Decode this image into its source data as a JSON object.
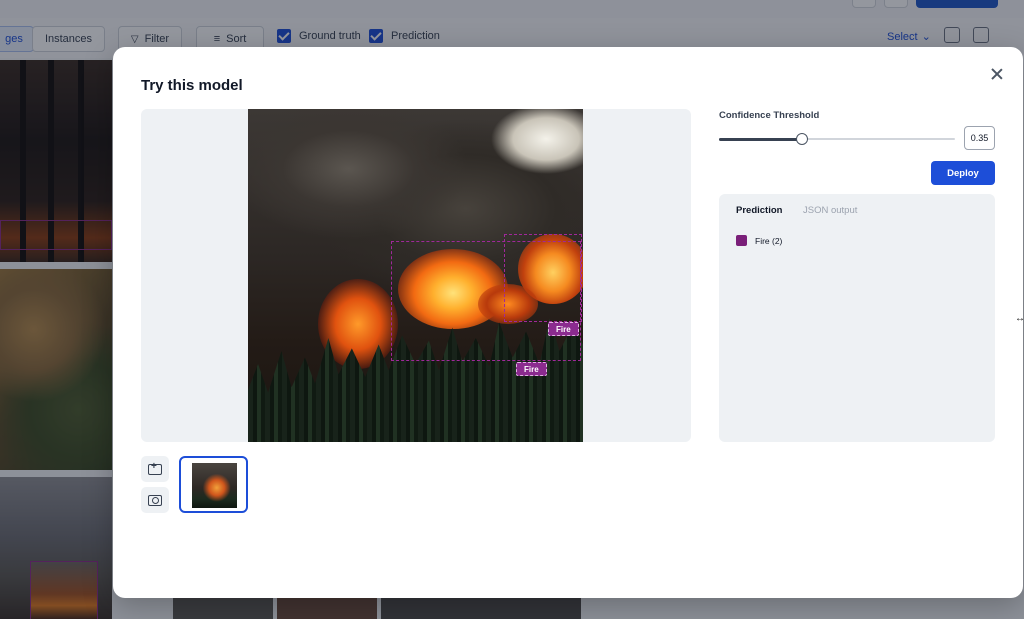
{
  "background": {
    "view_tabs": [
      "ges",
      "Instances"
    ],
    "filter_label": "Filter",
    "sort_label": "Sort",
    "ground_truth_label": "Ground truth",
    "prediction_label": "Prediction",
    "select_label": "Select"
  },
  "modal": {
    "title": "Try this model",
    "confidence_label": "Confidence Threshold",
    "confidence_value": "0.35",
    "confidence_fraction": 0.35,
    "deploy_label": "Deploy",
    "tabs": {
      "prediction": "Prediction",
      "json": "JSON output"
    },
    "predictions": [
      {
        "label": "Fire (2)",
        "color": "#7a1f79"
      }
    ],
    "box_labels": [
      "Fire",
      "Fire"
    ]
  },
  "colors": {
    "accent": "#1d4ed8",
    "fire_class": "#8b2b8f"
  }
}
